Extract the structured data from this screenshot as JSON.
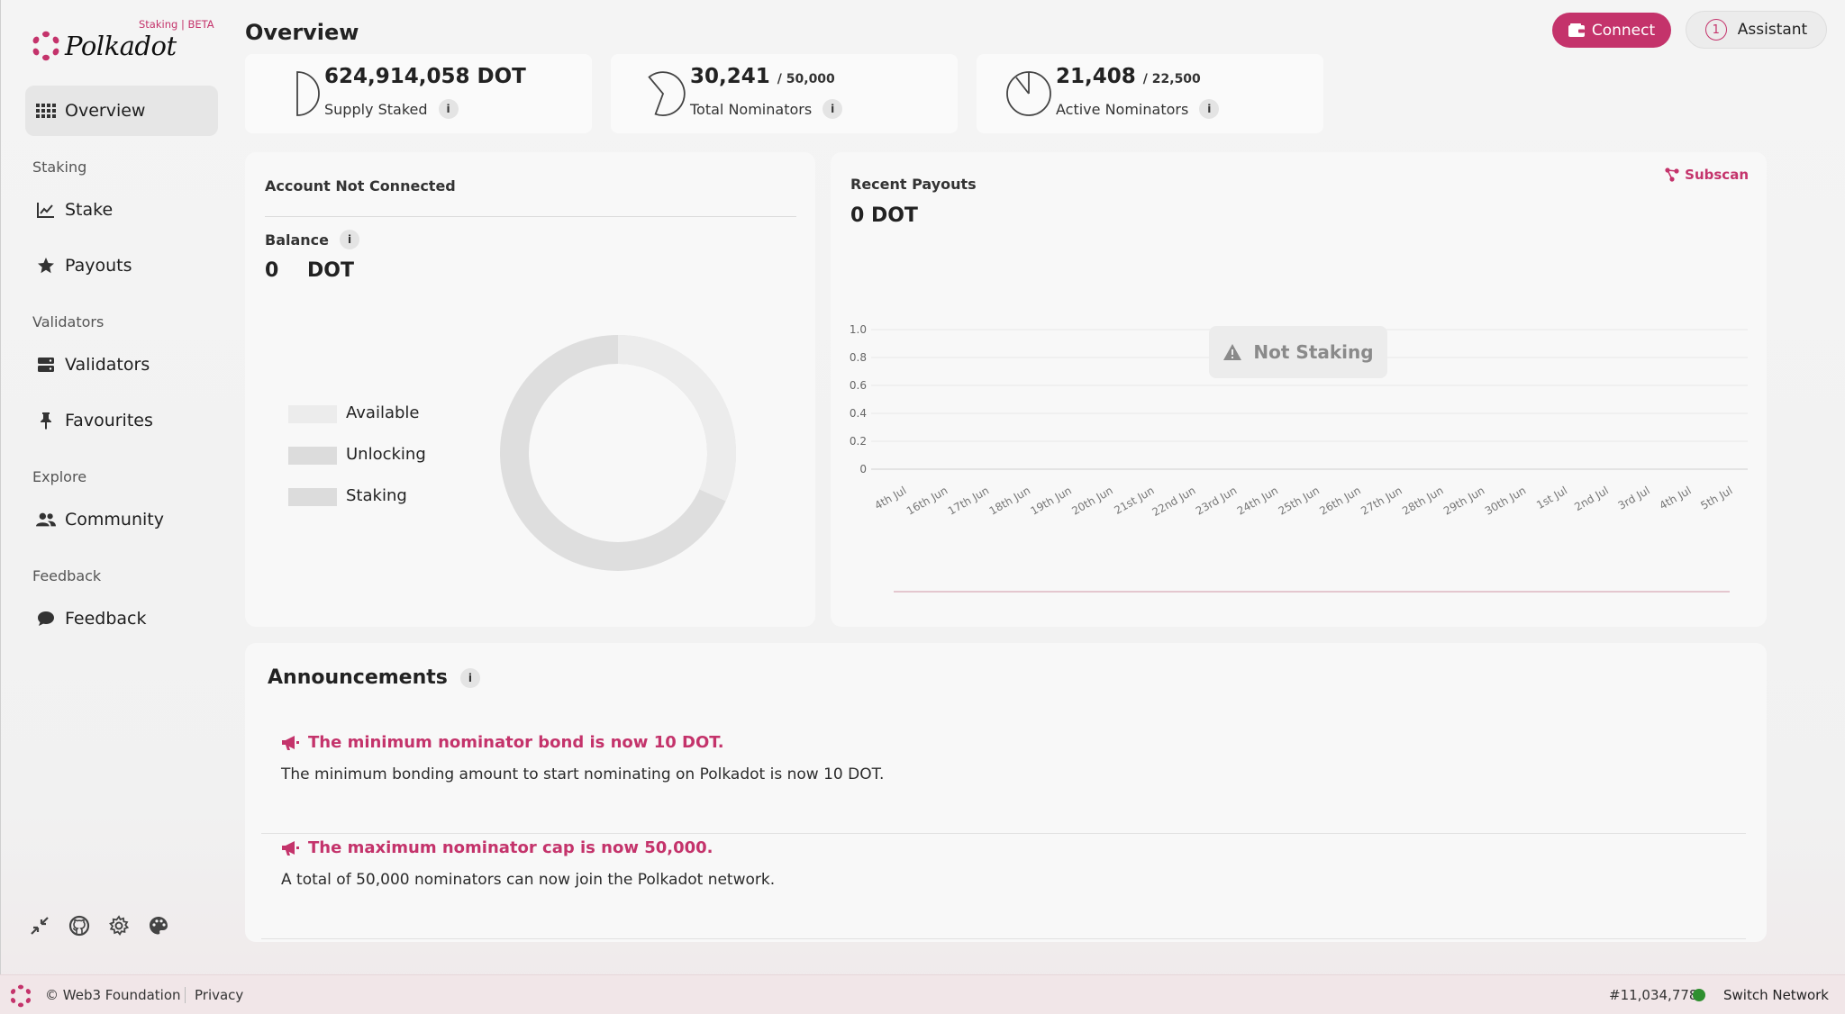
{
  "app": {
    "brand": "Polkadot",
    "tag": "Staking | BETA",
    "page_title": "Overview",
    "accent_color": "#c4336b"
  },
  "header": {
    "connect_label": "Connect",
    "assistant_label": "Assistant",
    "assistant_count": "1"
  },
  "sidebar": {
    "items": [
      {
        "label": "Overview",
        "icon": "grid-icon",
        "active": true
      },
      {
        "label": "Stake",
        "icon": "chart-line-icon"
      },
      {
        "label": "Payouts",
        "icon": "star-icon"
      },
      {
        "label": "Validators",
        "icon": "server-icon"
      },
      {
        "label": "Favourites",
        "icon": "pin-icon"
      },
      {
        "label": "Community",
        "icon": "users-icon"
      },
      {
        "label": "Feedback",
        "icon": "comment-icon"
      }
    ],
    "sections": [
      "Staking",
      "Validators",
      "Explore",
      "Feedback"
    ],
    "tools": [
      "collapse-icon",
      "github-icon",
      "settings-icon",
      "palette-icon"
    ]
  },
  "stats": [
    {
      "value": "624,914,058 DOT",
      "sub": "",
      "label": "Supply Staked"
    },
    {
      "value": "30,241",
      "sub": "/ 50,000",
      "label": "Total Nominators"
    },
    {
      "value": "21,408",
      "sub": "/ 22,500",
      "label": "Active Nominators"
    }
  ],
  "account": {
    "title": "Account Not Connected",
    "balance_label": "Balance",
    "balance_value": "0",
    "balance_unit": "DOT",
    "legend": [
      "Available",
      "Unlocking",
      "Staking"
    ]
  },
  "payouts": {
    "title": "Recent Payouts",
    "amount": "0 DOT",
    "subscan_label": "Subscan",
    "not_staking": "Not Staking"
  },
  "chart_data": {
    "type": "bar",
    "categories": [
      "4th Jul",
      "16th Jun",
      "17th Jun",
      "18th Jun",
      "19th Jun",
      "20th Jun",
      "21st Jun",
      "22nd Jun",
      "23rd Jun",
      "24th Jun",
      "25th Jun",
      "26th Jun",
      "27th Jun",
      "28th Jun",
      "29th Jun",
      "30th Jun",
      "1st Jul",
      "2nd Jul",
      "3rd Jul",
      "4th Jul",
      "5th Jul"
    ],
    "values": [
      0,
      0,
      0,
      0,
      0,
      0,
      0,
      0,
      0,
      0,
      0,
      0,
      0,
      0,
      0,
      0,
      0,
      0,
      0,
      0,
      0
    ],
    "yticks": [
      "1.0",
      "0.8",
      "0.6",
      "0.4",
      "0.2",
      "0"
    ],
    "ylim": [
      0,
      1
    ],
    "grid": true
  },
  "announcements": {
    "title": "Announcements",
    "items": [
      {
        "title": "The minimum nominator bond is now 10 DOT.",
        "body": "The minimum bonding amount to start nominating on Polkadot is now 10 DOT."
      },
      {
        "title": "The maximum nominator cap is now 50,000.",
        "body": "A total of 50,000 nominators can now join the Polkadot network."
      }
    ]
  },
  "footer": {
    "copyright": "© Web3 Foundation",
    "privacy": "Privacy",
    "block": "#11,034,778",
    "switch_network": "Switch Network"
  }
}
